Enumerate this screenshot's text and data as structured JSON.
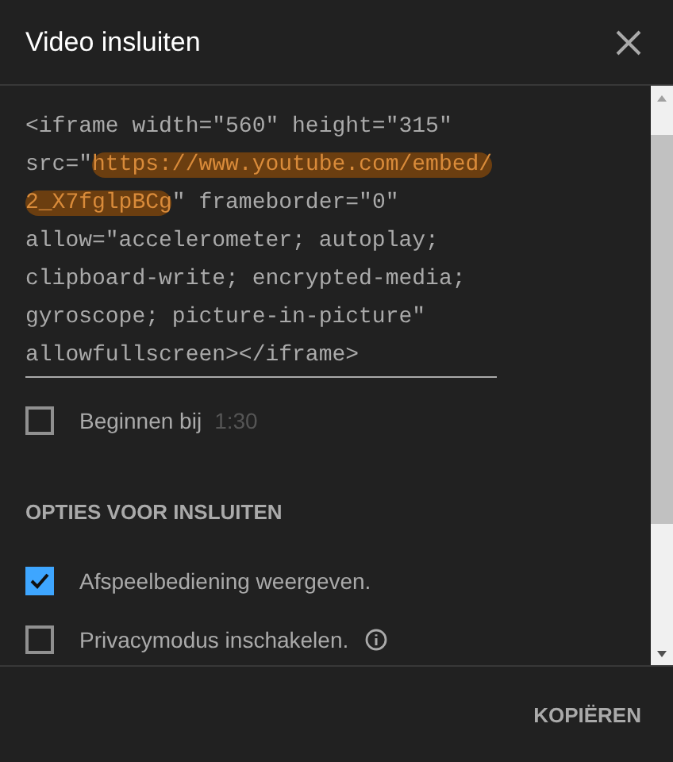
{
  "dialog": {
    "title": "Video insluiten"
  },
  "embed_code": {
    "lines": [
      [
        {
          "text": "<iframe width=\"560\" height=\"315\"",
          "highlighted": false
        }
      ],
      [
        {
          "text": "src=\"",
          "highlighted": false
        },
        {
          "text": "https://www.youtube.com/embed/",
          "highlighted": true
        }
      ],
      [
        {
          "text": "2_X7fglpBCg",
          "highlighted": true
        },
        {
          "text": "\" frameborder=\"0\"",
          "highlighted": false
        }
      ],
      [
        {
          "text": "allow=\"accelerometer; autoplay;",
          "highlighted": false
        }
      ],
      [
        {
          "text": "clipboard-write; encrypted-media;",
          "highlighted": false
        }
      ],
      [
        {
          "text": "gyroscope; picture-in-picture\"",
          "highlighted": false
        }
      ],
      [
        {
          "text": "allowfullscreen></iframe>",
          "highlighted": false
        }
      ]
    ]
  },
  "start_at": {
    "label": "Beginnen bij",
    "checked": false,
    "time": "1:30"
  },
  "section_title": "OPTIES VOOR INSLUITEN",
  "options": [
    {
      "label": "Afspeelbediening weergeven.",
      "checked": true,
      "info": false
    },
    {
      "label": "Privacymodus inschakelen.",
      "checked": false,
      "info": true
    }
  ],
  "copy_button": "KOPIËREN"
}
